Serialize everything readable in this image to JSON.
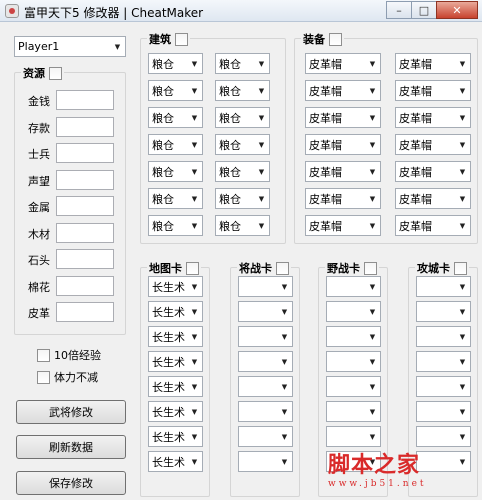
{
  "window": {
    "title": "富甲天下5 修改器 | CheatMaker",
    "min_glyph": "–",
    "max_glyph": "□",
    "close_glyph": "✕"
  },
  "player_select": {
    "value": "Player1"
  },
  "resources": {
    "title": "资源",
    "fields": [
      {
        "label": "金钱",
        "value": ""
      },
      {
        "label": "存款",
        "value": ""
      },
      {
        "label": "士兵",
        "value": ""
      },
      {
        "label": "声望",
        "value": ""
      },
      {
        "label": "金属",
        "value": ""
      },
      {
        "label": "木材",
        "value": ""
      },
      {
        "label": "石头",
        "value": ""
      },
      {
        "label": "棉花",
        "value": ""
      },
      {
        "label": "皮革",
        "value": ""
      }
    ]
  },
  "options": {
    "double_exp": "10倍经验",
    "stamina": "体力不减"
  },
  "buttons": {
    "general": "武将修改",
    "refresh": "刷新数据",
    "save": "保存修改"
  },
  "building": {
    "title": "建筑",
    "value": "粮仓"
  },
  "equipment": {
    "title": "装备",
    "value": "皮革帽"
  },
  "map_card": {
    "title": "地图卡",
    "value": "长生术"
  },
  "battle_card": {
    "title": "将战卡",
    "value": ""
  },
  "field_card": {
    "title": "野战卡",
    "value": ""
  },
  "siege_card": {
    "title": "攻城卡",
    "value": ""
  },
  "watermark": {
    "main": "脚本之家",
    "sub": "www.jb51.net"
  }
}
